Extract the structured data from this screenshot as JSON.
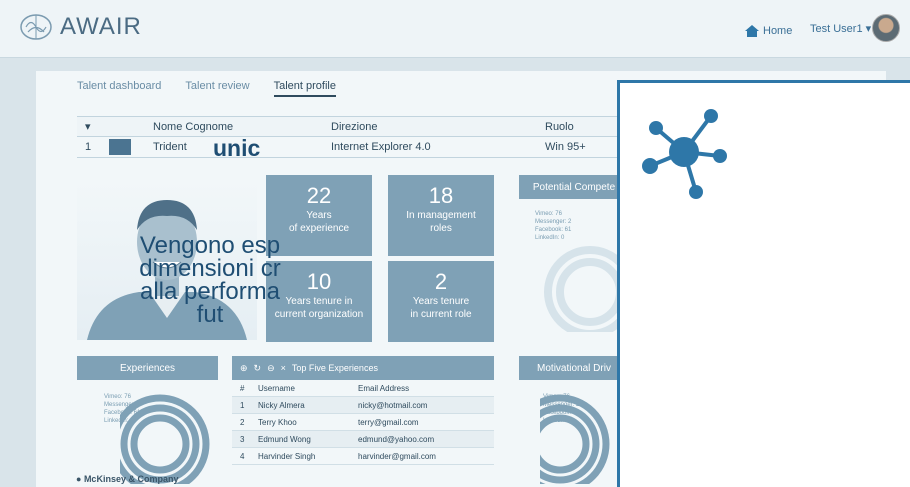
{
  "header": {
    "brand": "AWAIR",
    "home_label": "Home",
    "user_label": "Test User1 ▾"
  },
  "tabs": [
    "Talent dashboard",
    "Talent review",
    "Talent profile"
  ],
  "employee_table": {
    "columns": [
      "Nome Cognome",
      "Direzione",
      "Ruolo"
    ],
    "rows": [
      {
        "index": "1",
        "name": "Trident",
        "direction": "Internet Explorer 4.0",
        "role": "Win 95+"
      }
    ]
  },
  "stats": [
    {
      "value": "22",
      "label_1": "Years",
      "label_2": "of experience"
    },
    {
      "value": "18",
      "label_1": "In management",
      "label_2": "roles"
    },
    {
      "value": "10",
      "label_1": "Years tenure in",
      "label_2": "current organization"
    },
    {
      "value": "2",
      "label_1": "Years tenure",
      "label_2": "in current role"
    }
  ],
  "sections": {
    "potential": "Potential Compete",
    "experiences": "Experiences",
    "motivational": "Motivational Driv"
  },
  "top_five": {
    "title": "Top Five Experiences",
    "columns": [
      "#",
      "Username",
      "Email Address"
    ],
    "rows": [
      {
        "n": "1",
        "user": "Nicky Almera",
        "email": "nicky@hotmail.com"
      },
      {
        "n": "2",
        "user": "Terry Khoo",
        "email": "terry@gmail.com"
      },
      {
        "n": "3",
        "user": "Edmund Wong",
        "email": "edmund@yahoo.com"
      },
      {
        "n": "4",
        "user": "Harvinder Singh",
        "email": "harvinder@gmail.com"
      }
    ]
  },
  "legend": [
    "Vimeo: 76",
    "Messenger: 2",
    "Facebook: 61",
    "LinkedIn: 0"
  ],
  "footer_company": "McKinsey & Company",
  "overlay": {
    "title": "unic",
    "line1": "Vengono esp",
    "line2": "dimensioni cr",
    "line3": "alla performa",
    "line4": "fut"
  }
}
